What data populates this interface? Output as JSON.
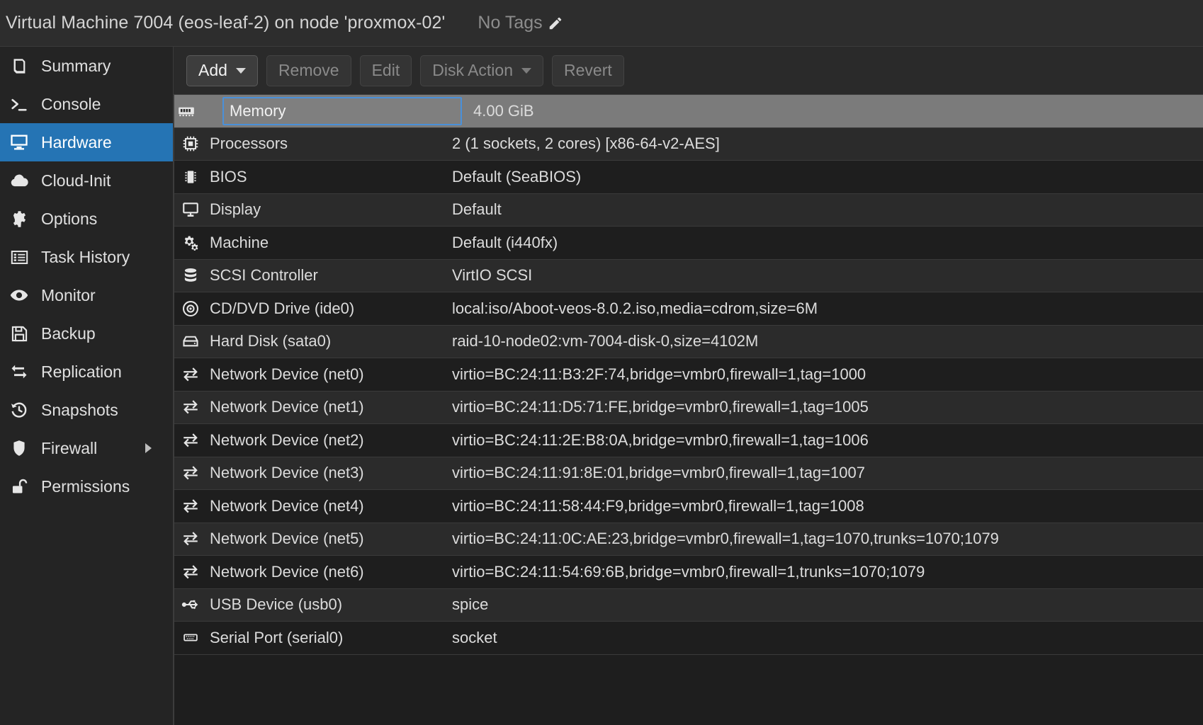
{
  "header": {
    "title": "Virtual Machine 7004 (eos-leaf-2) on node 'proxmox-02'",
    "tags_label": "No Tags",
    "edit_tags_icon": "pencil-icon"
  },
  "sidebar": {
    "items": [
      {
        "label": "Summary",
        "icon": "book-icon",
        "selected": false,
        "has_submenu": false
      },
      {
        "label": "Console",
        "icon": "terminal-icon",
        "selected": false,
        "has_submenu": false
      },
      {
        "label": "Hardware",
        "icon": "monitor-icon",
        "selected": true,
        "has_submenu": false
      },
      {
        "label": "Cloud-Init",
        "icon": "cloud-icon",
        "selected": false,
        "has_submenu": false
      },
      {
        "label": "Options",
        "icon": "gear-icon",
        "selected": false,
        "has_submenu": false
      },
      {
        "label": "Task History",
        "icon": "list-icon",
        "selected": false,
        "has_submenu": false
      },
      {
        "label": "Monitor",
        "icon": "eye-icon",
        "selected": false,
        "has_submenu": false
      },
      {
        "label": "Backup",
        "icon": "floppy-icon",
        "selected": false,
        "has_submenu": false
      },
      {
        "label": "Replication",
        "icon": "replication-icon",
        "selected": false,
        "has_submenu": false
      },
      {
        "label": "Snapshots",
        "icon": "history-icon",
        "selected": false,
        "has_submenu": false
      },
      {
        "label": "Firewall",
        "icon": "shield-icon",
        "selected": false,
        "has_submenu": true
      },
      {
        "label": "Permissions",
        "icon": "unlock-icon",
        "selected": false,
        "has_submenu": false
      }
    ]
  },
  "toolbar": {
    "buttons": [
      {
        "label": "Add",
        "enabled": true,
        "caret": true
      },
      {
        "label": "Remove",
        "enabled": false,
        "caret": false
      },
      {
        "label": "Edit",
        "enabled": false,
        "caret": false
      },
      {
        "label": "Disk Action",
        "enabled": false,
        "caret": true
      },
      {
        "label": "Revert",
        "enabled": false,
        "caret": false
      }
    ]
  },
  "hardware_table": {
    "rows": [
      {
        "name": "Memory",
        "value": "4.00 GiB",
        "icon": "memory-icon",
        "selected": true
      },
      {
        "name": "Processors",
        "value": "2 (1 sockets, 2 cores) [x86-64-v2-AES]",
        "icon": "cpu-icon",
        "selected": false
      },
      {
        "name": "BIOS",
        "value": "Default (SeaBIOS)",
        "icon": "bios-icon",
        "selected": false
      },
      {
        "name": "Display",
        "value": "Default",
        "icon": "display-icon",
        "selected": false
      },
      {
        "name": "Machine",
        "value": "Default (i440fx)",
        "icon": "gears-icon",
        "selected": false
      },
      {
        "name": "SCSI Controller",
        "value": "VirtIO SCSI",
        "icon": "database-icon",
        "selected": false
      },
      {
        "name": "CD/DVD Drive (ide0)",
        "value": "local:iso/Aboot-veos-8.0.2.iso,media=cdrom,size=6M",
        "icon": "disc-icon",
        "selected": false
      },
      {
        "name": "Hard Disk (sata0)",
        "value": "raid-10-node02:vm-7004-disk-0,size=4102M",
        "icon": "harddisk-icon",
        "selected": false
      },
      {
        "name": "Network Device (net0)",
        "value": "virtio=BC:24:11:B3:2F:74,bridge=vmbr0,firewall=1,tag=1000",
        "icon": "network-icon",
        "selected": false
      },
      {
        "name": "Network Device (net1)",
        "value": "virtio=BC:24:11:D5:71:FE,bridge=vmbr0,firewall=1,tag=1005",
        "icon": "network-icon",
        "selected": false
      },
      {
        "name": "Network Device (net2)",
        "value": "virtio=BC:24:11:2E:B8:0A,bridge=vmbr0,firewall=1,tag=1006",
        "icon": "network-icon",
        "selected": false
      },
      {
        "name": "Network Device (net3)",
        "value": "virtio=BC:24:11:91:8E:01,bridge=vmbr0,firewall=1,tag=1007",
        "icon": "network-icon",
        "selected": false
      },
      {
        "name": "Network Device (net4)",
        "value": "virtio=BC:24:11:58:44:F9,bridge=vmbr0,firewall=1,tag=1008",
        "icon": "network-icon",
        "selected": false
      },
      {
        "name": "Network Device (net5)",
        "value": "virtio=BC:24:11:0C:AE:23,bridge=vmbr0,firewall=1,tag=1070,trunks=1070;1079",
        "icon": "network-icon",
        "selected": false
      },
      {
        "name": "Network Device (net6)",
        "value": "virtio=BC:24:11:54:69:6B,bridge=vmbr0,firewall=1,trunks=1070;1079",
        "icon": "network-icon",
        "selected": false
      },
      {
        "name": "USB Device (usb0)",
        "value": "spice",
        "icon": "usb-icon",
        "selected": false
      },
      {
        "name": "Serial Port (serial0)",
        "value": "socket",
        "icon": "serial-icon",
        "selected": false
      }
    ]
  },
  "colors": {
    "accent": "#2574b4",
    "selection": "#7b7b7b",
    "focus_outline": "#4a90d9",
    "background": "#1e1e1e",
    "sidebar_background": "#242424",
    "text": "#dcdcdc"
  }
}
